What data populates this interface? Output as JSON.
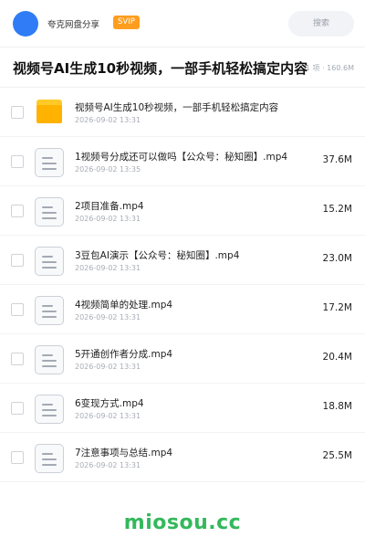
{
  "header": {
    "user_name": "夸克网盘分享",
    "badge": "SVIP",
    "search_label": "搜索"
  },
  "share": {
    "title": "视频号AI生成10秒视频，一部手机轻松搞定内容",
    "meta": "1 项 · 160.6M"
  },
  "files": [
    {
      "name": "视频号AI生成10秒视频，一部手机轻松搞定内容",
      "date": "2026-09-02 13:31",
      "size": "",
      "type": "folder"
    },
    {
      "name": "1视频号分成还可以做吗【公众号：秘知圈】.mp4",
      "date": "2026-09-02 13:35",
      "size": "37.6M",
      "type": "video"
    },
    {
      "name": "2项目准备.mp4",
      "date": "2026-09-02 13:31",
      "size": "15.2M",
      "type": "video"
    },
    {
      "name": "3豆包AI演示【公众号：秘知圈】.mp4",
      "date": "2026-09-02 13:31",
      "size": "23.0M",
      "type": "video"
    },
    {
      "name": "4视频简单的处理.mp4",
      "date": "2026-09-02 13:31",
      "size": "17.2M",
      "type": "video"
    },
    {
      "name": "5开通创作者分成.mp4",
      "date": "2026-09-02 13:31",
      "size": "20.4M",
      "type": "video"
    },
    {
      "name": "6变现方式.mp4",
      "date": "2026-09-02 13:31",
      "size": "18.8M",
      "type": "video"
    },
    {
      "name": "7注意事项与总结.mp4",
      "date": "2026-09-02 13:31",
      "size": "25.5M",
      "type": "video"
    }
  ],
  "watermark": "miosou.cc",
  "colors": {
    "accent": "#2f7cf6",
    "badge": "#ff9d1f",
    "folder": "#ffb300",
    "watermark": "#34b85c"
  }
}
